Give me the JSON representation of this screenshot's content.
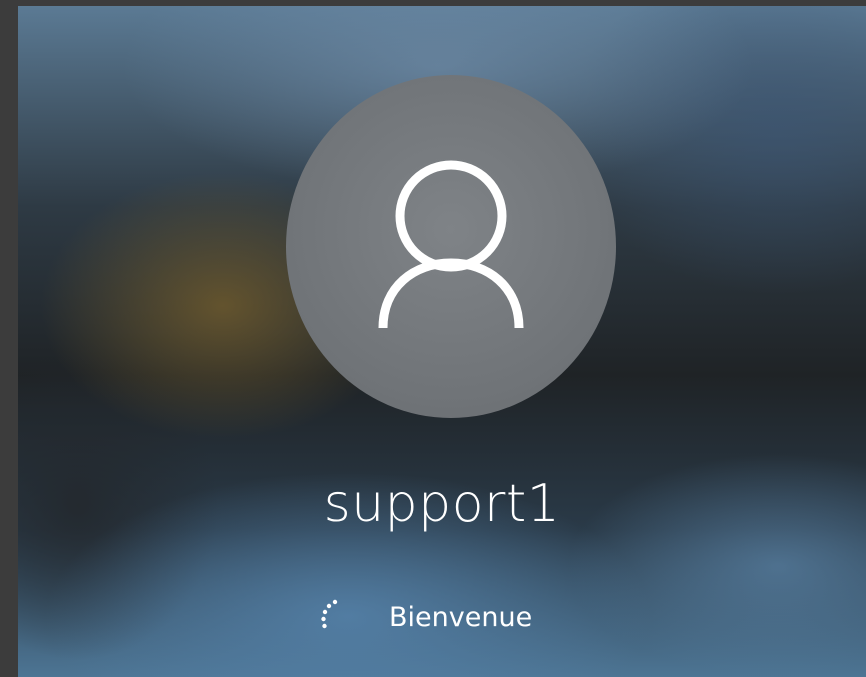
{
  "login_screen": {
    "user": {
      "avatar_icon": "user-silhouette-icon",
      "name": "support1"
    },
    "status": {
      "spinner_icon": "loading-spinner-icon",
      "text": "Bienvenue"
    },
    "colors": {
      "text": "#ffffff",
      "avatar_circle": "#74787c"
    }
  }
}
